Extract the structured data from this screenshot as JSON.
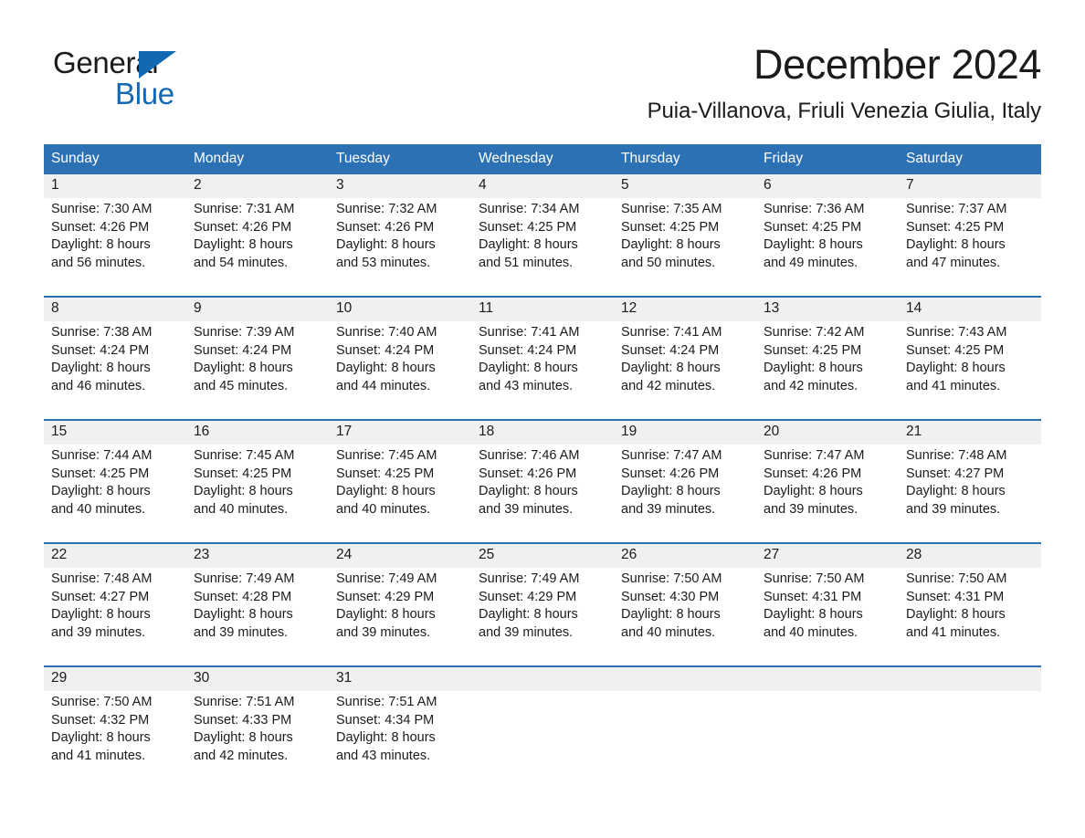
{
  "brand": {
    "logo_line1": "General",
    "logo_line2": "Blue",
    "logo_triangle_icon": "triangle-icon",
    "black": "#1b1b1b",
    "blue": "#1268b3"
  },
  "header": {
    "title": "December 2024",
    "location": "Puia-Villanova, Friuli Venezia Giulia, Italy"
  },
  "theme": {
    "header_blue": "#2d71b5",
    "daynum_band": "#f0f0f0",
    "text": "#1b1b1b"
  },
  "weekdays": [
    "Sunday",
    "Monday",
    "Tuesday",
    "Wednesday",
    "Thursday",
    "Friday",
    "Saturday"
  ],
  "weeks": [
    {
      "days": [
        {
          "num": "1",
          "sunrise": "Sunrise: 7:30 AM",
          "sunset": "Sunset: 4:26 PM",
          "daylight1": "Daylight: 8 hours",
          "daylight2": "and 56 minutes."
        },
        {
          "num": "2",
          "sunrise": "Sunrise: 7:31 AM",
          "sunset": "Sunset: 4:26 PM",
          "daylight1": "Daylight: 8 hours",
          "daylight2": "and 54 minutes."
        },
        {
          "num": "3",
          "sunrise": "Sunrise: 7:32 AM",
          "sunset": "Sunset: 4:26 PM",
          "daylight1": "Daylight: 8 hours",
          "daylight2": "and 53 minutes."
        },
        {
          "num": "4",
          "sunrise": "Sunrise: 7:34 AM",
          "sunset": "Sunset: 4:25 PM",
          "daylight1": "Daylight: 8 hours",
          "daylight2": "and 51 minutes."
        },
        {
          "num": "5",
          "sunrise": "Sunrise: 7:35 AM",
          "sunset": "Sunset: 4:25 PM",
          "daylight1": "Daylight: 8 hours",
          "daylight2": "and 50 minutes."
        },
        {
          "num": "6",
          "sunrise": "Sunrise: 7:36 AM",
          "sunset": "Sunset: 4:25 PM",
          "daylight1": "Daylight: 8 hours",
          "daylight2": "and 49 minutes."
        },
        {
          "num": "7",
          "sunrise": "Sunrise: 7:37 AM",
          "sunset": "Sunset: 4:25 PM",
          "daylight1": "Daylight: 8 hours",
          "daylight2": "and 47 minutes."
        }
      ]
    },
    {
      "days": [
        {
          "num": "8",
          "sunrise": "Sunrise: 7:38 AM",
          "sunset": "Sunset: 4:24 PM",
          "daylight1": "Daylight: 8 hours",
          "daylight2": "and 46 minutes."
        },
        {
          "num": "9",
          "sunrise": "Sunrise: 7:39 AM",
          "sunset": "Sunset: 4:24 PM",
          "daylight1": "Daylight: 8 hours",
          "daylight2": "and 45 minutes."
        },
        {
          "num": "10",
          "sunrise": "Sunrise: 7:40 AM",
          "sunset": "Sunset: 4:24 PM",
          "daylight1": "Daylight: 8 hours",
          "daylight2": "and 44 minutes."
        },
        {
          "num": "11",
          "sunrise": "Sunrise: 7:41 AM",
          "sunset": "Sunset: 4:24 PM",
          "daylight1": "Daylight: 8 hours",
          "daylight2": "and 43 minutes."
        },
        {
          "num": "12",
          "sunrise": "Sunrise: 7:41 AM",
          "sunset": "Sunset: 4:24 PM",
          "daylight1": "Daylight: 8 hours",
          "daylight2": "and 42 minutes."
        },
        {
          "num": "13",
          "sunrise": "Sunrise: 7:42 AM",
          "sunset": "Sunset: 4:25 PM",
          "daylight1": "Daylight: 8 hours",
          "daylight2": "and 42 minutes."
        },
        {
          "num": "14",
          "sunrise": "Sunrise: 7:43 AM",
          "sunset": "Sunset: 4:25 PM",
          "daylight1": "Daylight: 8 hours",
          "daylight2": "and 41 minutes."
        }
      ]
    },
    {
      "days": [
        {
          "num": "15",
          "sunrise": "Sunrise: 7:44 AM",
          "sunset": "Sunset: 4:25 PM",
          "daylight1": "Daylight: 8 hours",
          "daylight2": "and 40 minutes."
        },
        {
          "num": "16",
          "sunrise": "Sunrise: 7:45 AM",
          "sunset": "Sunset: 4:25 PM",
          "daylight1": "Daylight: 8 hours",
          "daylight2": "and 40 minutes."
        },
        {
          "num": "17",
          "sunrise": "Sunrise: 7:45 AM",
          "sunset": "Sunset: 4:25 PM",
          "daylight1": "Daylight: 8 hours",
          "daylight2": "and 40 minutes."
        },
        {
          "num": "18",
          "sunrise": "Sunrise: 7:46 AM",
          "sunset": "Sunset: 4:26 PM",
          "daylight1": "Daylight: 8 hours",
          "daylight2": "and 39 minutes."
        },
        {
          "num": "19",
          "sunrise": "Sunrise: 7:47 AM",
          "sunset": "Sunset: 4:26 PM",
          "daylight1": "Daylight: 8 hours",
          "daylight2": "and 39 minutes."
        },
        {
          "num": "20",
          "sunrise": "Sunrise: 7:47 AM",
          "sunset": "Sunset: 4:26 PM",
          "daylight1": "Daylight: 8 hours",
          "daylight2": "and 39 minutes."
        },
        {
          "num": "21",
          "sunrise": "Sunrise: 7:48 AM",
          "sunset": "Sunset: 4:27 PM",
          "daylight1": "Daylight: 8 hours",
          "daylight2": "and 39 minutes."
        }
      ]
    },
    {
      "days": [
        {
          "num": "22",
          "sunrise": "Sunrise: 7:48 AM",
          "sunset": "Sunset: 4:27 PM",
          "daylight1": "Daylight: 8 hours",
          "daylight2": "and 39 minutes."
        },
        {
          "num": "23",
          "sunrise": "Sunrise: 7:49 AM",
          "sunset": "Sunset: 4:28 PM",
          "daylight1": "Daylight: 8 hours",
          "daylight2": "and 39 minutes."
        },
        {
          "num": "24",
          "sunrise": "Sunrise: 7:49 AM",
          "sunset": "Sunset: 4:29 PM",
          "daylight1": "Daylight: 8 hours",
          "daylight2": "and 39 minutes."
        },
        {
          "num": "25",
          "sunrise": "Sunrise: 7:49 AM",
          "sunset": "Sunset: 4:29 PM",
          "daylight1": "Daylight: 8 hours",
          "daylight2": "and 39 minutes."
        },
        {
          "num": "26",
          "sunrise": "Sunrise: 7:50 AM",
          "sunset": "Sunset: 4:30 PM",
          "daylight1": "Daylight: 8 hours",
          "daylight2": "and 40 minutes."
        },
        {
          "num": "27",
          "sunrise": "Sunrise: 7:50 AM",
          "sunset": "Sunset: 4:31 PM",
          "daylight1": "Daylight: 8 hours",
          "daylight2": "and 40 minutes."
        },
        {
          "num": "28",
          "sunrise": "Sunrise: 7:50 AM",
          "sunset": "Sunset: 4:31 PM",
          "daylight1": "Daylight: 8 hours",
          "daylight2": "and 41 minutes."
        }
      ]
    },
    {
      "days": [
        {
          "num": "29",
          "sunrise": "Sunrise: 7:50 AM",
          "sunset": "Sunset: 4:32 PM",
          "daylight1": "Daylight: 8 hours",
          "daylight2": "and 41 minutes."
        },
        {
          "num": "30",
          "sunrise": "Sunrise: 7:51 AM",
          "sunset": "Sunset: 4:33 PM",
          "daylight1": "Daylight: 8 hours",
          "daylight2": "and 42 minutes."
        },
        {
          "num": "31",
          "sunrise": "Sunrise: 7:51 AM",
          "sunset": "Sunset: 4:34 PM",
          "daylight1": "Daylight: 8 hours",
          "daylight2": "and 43 minutes."
        },
        {
          "num": "",
          "sunrise": "",
          "sunset": "",
          "daylight1": "",
          "daylight2": ""
        },
        {
          "num": "",
          "sunrise": "",
          "sunset": "",
          "daylight1": "",
          "daylight2": ""
        },
        {
          "num": "",
          "sunrise": "",
          "sunset": "",
          "daylight1": "",
          "daylight2": ""
        },
        {
          "num": "",
          "sunrise": "",
          "sunset": "",
          "daylight1": "",
          "daylight2": ""
        }
      ]
    }
  ]
}
